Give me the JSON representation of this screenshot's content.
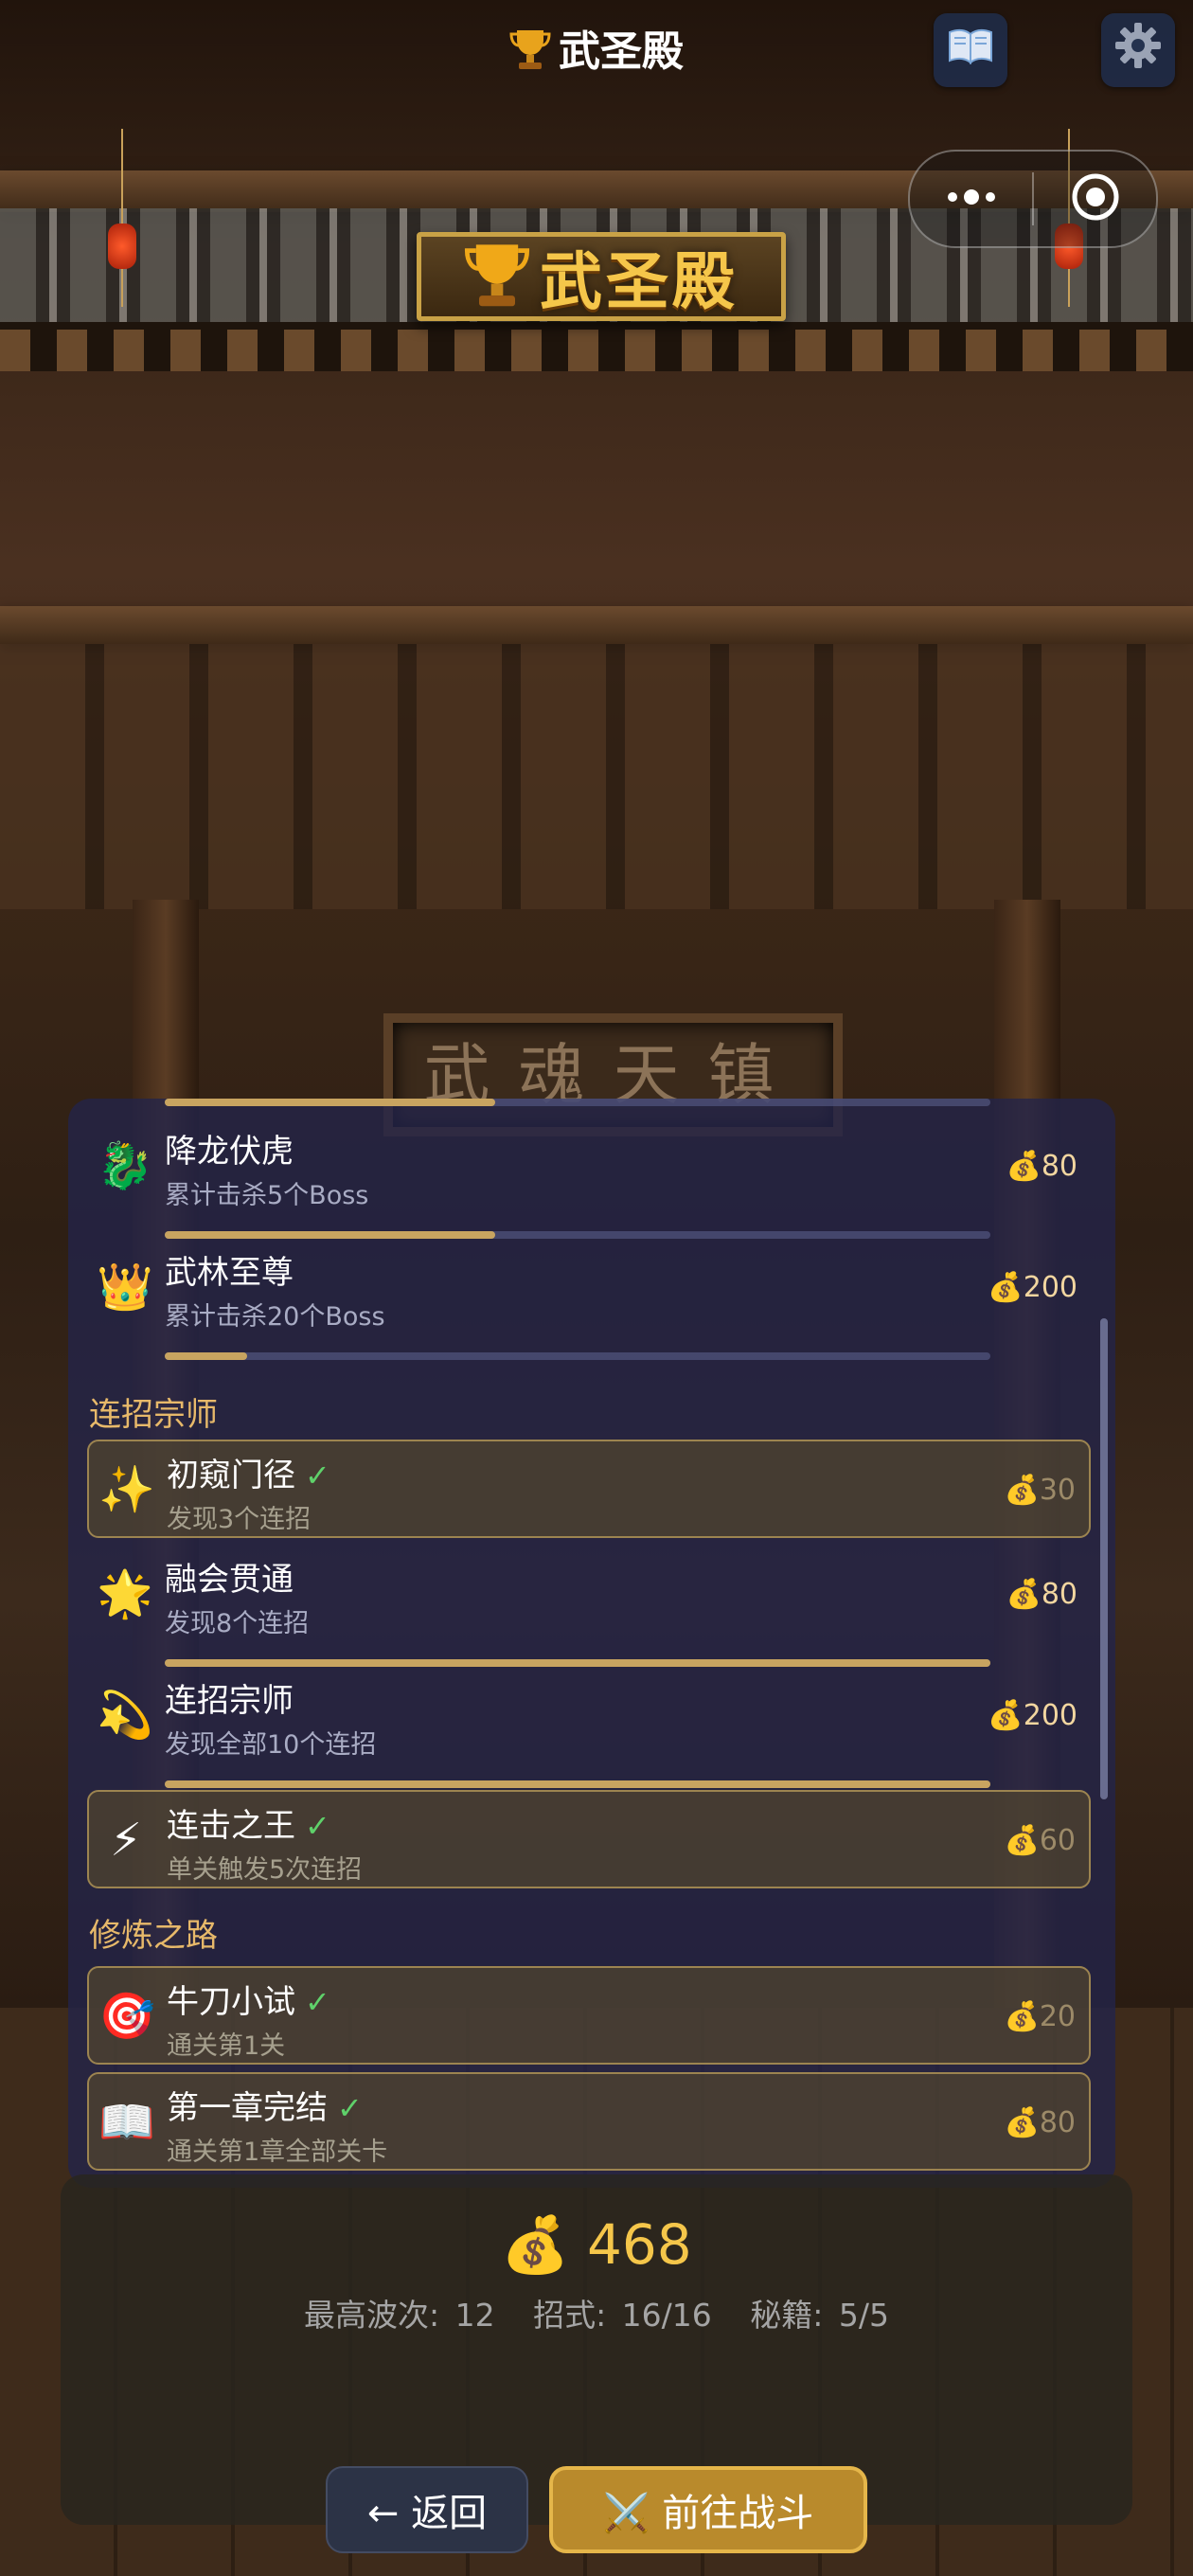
{
  "window": {
    "title": "武圣殿"
  },
  "toolbar": {
    "book_icon": "book-icon",
    "settings_icon": "gear-icon"
  },
  "capsule": {
    "more_icon": "more-dots-icon",
    "close_icon": "target-close-icon"
  },
  "sign": {
    "text": "武圣殿"
  },
  "background": {
    "plaque_text": "武魂天镇"
  },
  "achievements": {
    "items_top": [
      {
        "name": "降龙伏虎",
        "desc": "累计击杀5个Boss",
        "reward": "80",
        "icon": "dragon-icon",
        "completed": false,
        "progress": 0.4
      },
      {
        "name": "武林至尊",
        "desc": "累计击杀20个Boss",
        "reward": "200",
        "icon": "crown-icon",
        "completed": false,
        "progress": 0.1
      }
    ],
    "sections": [
      {
        "title": "连招宗师",
        "items": [
          {
            "name": "初窥门径",
            "desc": "发现3个连招",
            "reward": "30",
            "icon": "sparkles-icon",
            "completed": true
          },
          {
            "name": "融会贯通",
            "desc": "发现8个连招",
            "reward": "80",
            "icon": "star-burst-icon",
            "completed": false,
            "progress": 1.0
          },
          {
            "name": "连招宗师",
            "desc": "发现全部10个连招",
            "reward": "200",
            "icon": "comet-icon",
            "completed": false,
            "progress": 1.0
          },
          {
            "name": "连击之王",
            "desc": "单关触发5次连招",
            "reward": "60",
            "icon": "lightning-icon",
            "completed": true
          }
        ]
      },
      {
        "title": "修炼之路",
        "items": [
          {
            "name": "牛刀小试",
            "desc": "通关第1关",
            "reward": "20",
            "icon": "target-icon",
            "completed": true
          },
          {
            "name": "第一章完结",
            "desc": "通关第1章全部关卡",
            "reward": "80",
            "icon": "open-book-icon",
            "completed": true
          }
        ]
      }
    ]
  },
  "stats": {
    "coins": "468",
    "best_wave": "最高波次: 12",
    "moves": "招式: 16/16",
    "secrets": "秘籍: 5/5"
  },
  "buttons": {
    "back_label": "← 返回",
    "fight_label": "⚔️ 前往战斗"
  },
  "colors": {
    "accent_gold": "#f5c64a",
    "panel_bg": "#22244a",
    "check_green": "#5fd16a",
    "section_title": "#e7b96a"
  }
}
